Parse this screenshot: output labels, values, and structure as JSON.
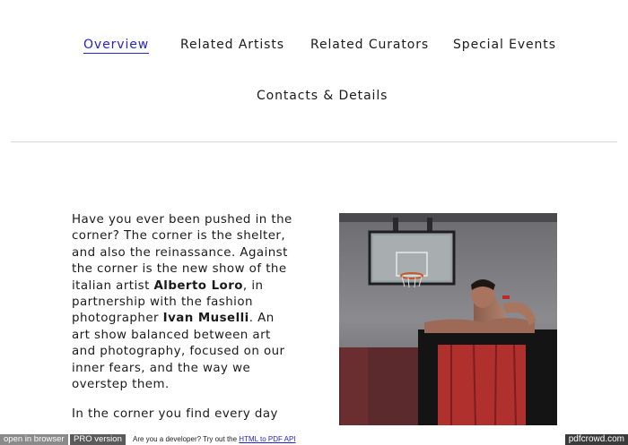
{
  "nav": {
    "items": [
      {
        "label": "Overview",
        "active": true
      },
      {
        "label": "Related Artists",
        "active": false
      },
      {
        "label": "Related Curators",
        "active": false
      },
      {
        "label": "Special Events",
        "active": false
      },
      {
        "label": "Contacts & Details",
        "active": false
      }
    ]
  },
  "article": {
    "p1": {
      "s1": "Have you ever been pushed in the corner? The corner is the shelter, and also the reinassance. Against the corner is the new show of the italian artist ",
      "artist": "Alberto Loro",
      "s2": ", in partnership with the fashion photographer ",
      "photographer": "Ivan Muselli",
      "s3": ". An art show balanced between art and photography, focused on our inner fears, and the way we overstep them."
    },
    "p2": "In the corner you find every day"
  },
  "pdfcrowd": {
    "open_label": "open in browser",
    "pro_label": "PRO version",
    "dev_text": "Are you a developer? Try out the ",
    "dev_link": "HTML to PDF API",
    "brand": "pdfcrowd.com"
  },
  "colors": {
    "link_active": "#2424c8",
    "text": "#1a1a1a",
    "divider": "#d8d8d8"
  }
}
